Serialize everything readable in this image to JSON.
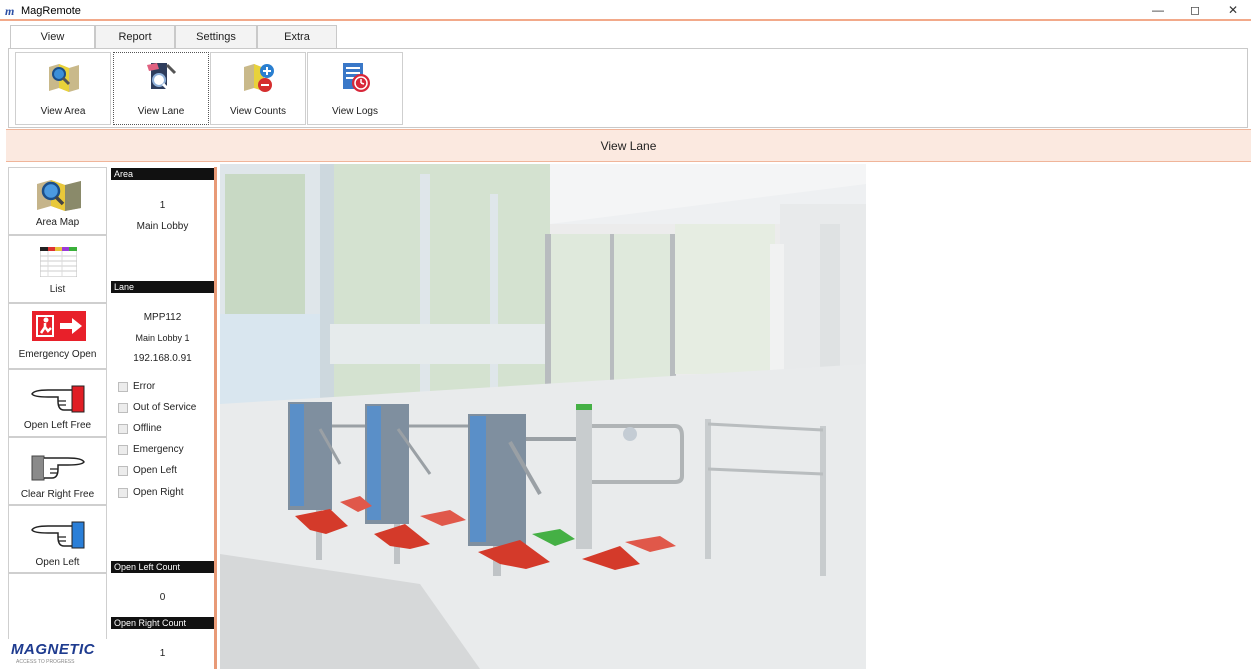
{
  "window": {
    "app_logo": "m",
    "title": "MagRemote",
    "minimize_glyph": "—",
    "restore_glyph": "◻",
    "close_glyph": "✕"
  },
  "tabs": [
    {
      "label": "View",
      "active": true
    },
    {
      "label": "Report",
      "active": false
    },
    {
      "label": "Settings",
      "active": false
    },
    {
      "label": "Extra",
      "active": false
    }
  ],
  "ribbon": {
    "buttons": [
      {
        "label": "View Area",
        "icon": "area-map-icon"
      },
      {
        "label": "View Lane",
        "icon": "lane-search-icon",
        "active": true
      },
      {
        "label": "View Counts",
        "icon": "counts-icon"
      },
      {
        "label": "View Logs",
        "icon": "logs-icon"
      }
    ]
  },
  "section_title": "View Lane",
  "leftnav": {
    "items": [
      {
        "label": "Area Map",
        "icon": "area-map-icon"
      },
      {
        "label": "List",
        "icon": "list-table-icon"
      },
      {
        "label": "Emergency Open",
        "icon": "emergency-exit-icon"
      },
      {
        "label": "Open Left Free",
        "icon": "hand-point-left-red-icon"
      },
      {
        "label": "Clear Right Free",
        "icon": "hand-point-right-gray-icon"
      },
      {
        "label": "Open Left",
        "icon": "hand-point-left-blue-icon"
      }
    ],
    "brand": "MAGNETIC",
    "brand_sub": "ACCESS TO PROGRESS"
  },
  "info": {
    "area_header": "Area",
    "area_number": "1",
    "area_name": "Main Lobby",
    "lane_header": "Lane",
    "lane_id": "MPP112",
    "lane_name": "Main Lobby 1",
    "lane_ip": "192.168.0.91",
    "statuses": [
      {
        "label": "Error",
        "checked": false
      },
      {
        "label": "Out of Service",
        "checked": false
      },
      {
        "label": "Offline",
        "checked": false
      },
      {
        "label": "Emergency",
        "checked": false
      },
      {
        "label": "Open Left",
        "checked": false
      },
      {
        "label": "Open Right",
        "checked": false
      }
    ],
    "open_left_count_header": "Open Left Count",
    "open_left_count": "0",
    "open_right_count_header": "Open Right Count",
    "open_right_count": "1"
  },
  "colors": {
    "accent": "#e89a77",
    "section_bg": "#fbe9e0",
    "brand_blue": "#1e3b8f",
    "arrow_red": "#d43a2a",
    "arrow_green": "#3fb33f"
  }
}
